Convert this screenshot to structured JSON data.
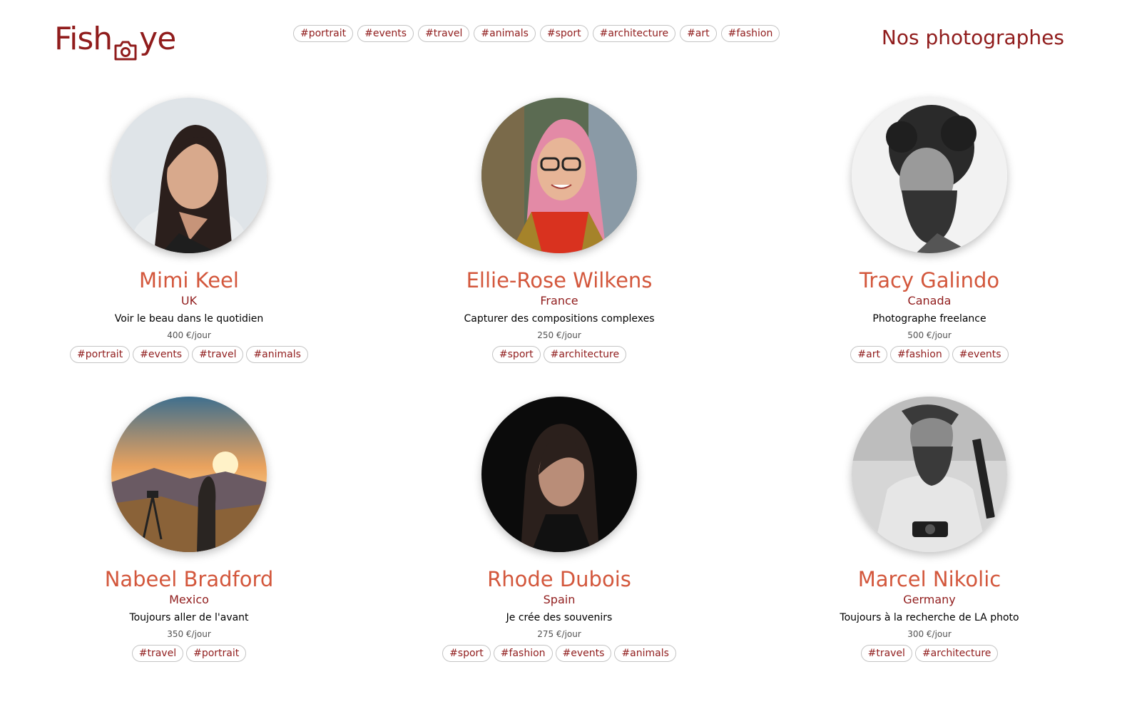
{
  "brand": {
    "logo_text_left": "Fish",
    "logo_text_right": "ye",
    "color": "#901C1C",
    "accent": "#D3573C"
  },
  "nav_tags": [
    "#portrait",
    "#events",
    "#travel",
    "#animals",
    "#sport",
    "#architecture",
    "#art",
    "#fashion"
  ],
  "page_title": "Nos photographes",
  "photographers": [
    {
      "name": "Mimi Keel",
      "location": "UK",
      "tagline": "Voir le beau dans le quotidien",
      "price": "400 €/jour",
      "tags": [
        "#portrait",
        "#events",
        "#travel",
        "#animals"
      ],
      "avatar": "portrait-young-woman-dark-hair"
    },
    {
      "name": "Ellie-Rose Wilkens",
      "location": "France",
      "tagline": "Capturer des compositions complexes",
      "price": "250 €/jour",
      "tags": [
        "#sport",
        "#architecture"
      ],
      "avatar": "portrait-woman-pink-hair-glasses"
    },
    {
      "name": "Tracy Galindo",
      "location": "Canada",
      "tagline": "Photographe freelance",
      "price": "500 €/jour",
      "tags": [
        "#art",
        "#fashion",
        "#events"
      ],
      "avatar": "bw-portrait-curly-man-beard"
    },
    {
      "name": "Nabeel Bradford",
      "location": "Mexico",
      "tagline": "Toujours aller de l'avant",
      "price": "350 €/jour",
      "tags": [
        "#travel",
        "#portrait"
      ],
      "avatar": "sunset-mountain-photographer"
    },
    {
      "name": "Rhode Dubois",
      "location": "Spain",
      "tagline": "Je crée des souvenirs",
      "price": "275 €/jour",
      "tags": [
        "#sport",
        "#fashion",
        "#events",
        "#animals"
      ],
      "avatar": "portrait-woman-dark-background"
    },
    {
      "name": "Marcel Nikolic",
      "location": "Germany",
      "tagline": "Toujours à la recherche de LA photo",
      "price": "300 €/jour",
      "tags": [
        "#travel",
        "#architecture"
      ],
      "avatar": "bw-man-beard-camera"
    }
  ]
}
